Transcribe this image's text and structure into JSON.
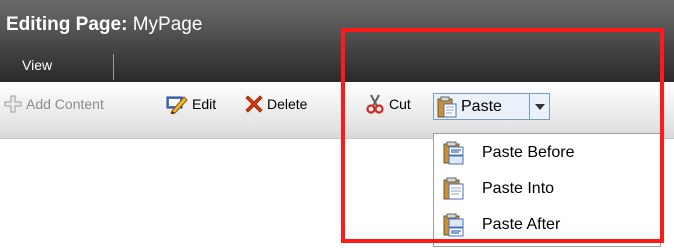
{
  "header": {
    "title_label": "Editing Page:",
    "page_name": "MyPage",
    "tabs": [
      {
        "label": "View"
      }
    ]
  },
  "toolbar": {
    "add_content": {
      "label": "Add Content",
      "icon": "add-icon",
      "disabled": true
    },
    "edit": {
      "label": "Edit",
      "icon": "edit-icon"
    },
    "delete": {
      "label": "Delete",
      "icon": "delete-icon",
      "color": "#d62a00"
    },
    "cut": {
      "label": "Cut",
      "icon": "scissors-icon"
    },
    "paste": {
      "label": "Paste",
      "icon": "clipboard-icon"
    }
  },
  "paste_menu": {
    "items": [
      {
        "label": "Paste Before",
        "icon": "paste-before-icon"
      },
      {
        "label": "Paste Into",
        "icon": "paste-into-icon"
      },
      {
        "label": "Paste After",
        "icon": "paste-after-icon"
      }
    ]
  },
  "colors": {
    "header_dark": "#2a2a2a",
    "header_light": "#6a6a6a",
    "highlight_border": "#ff1a1a",
    "button_border": "#7a9cc2",
    "button_bg": "#eaf1fa"
  }
}
